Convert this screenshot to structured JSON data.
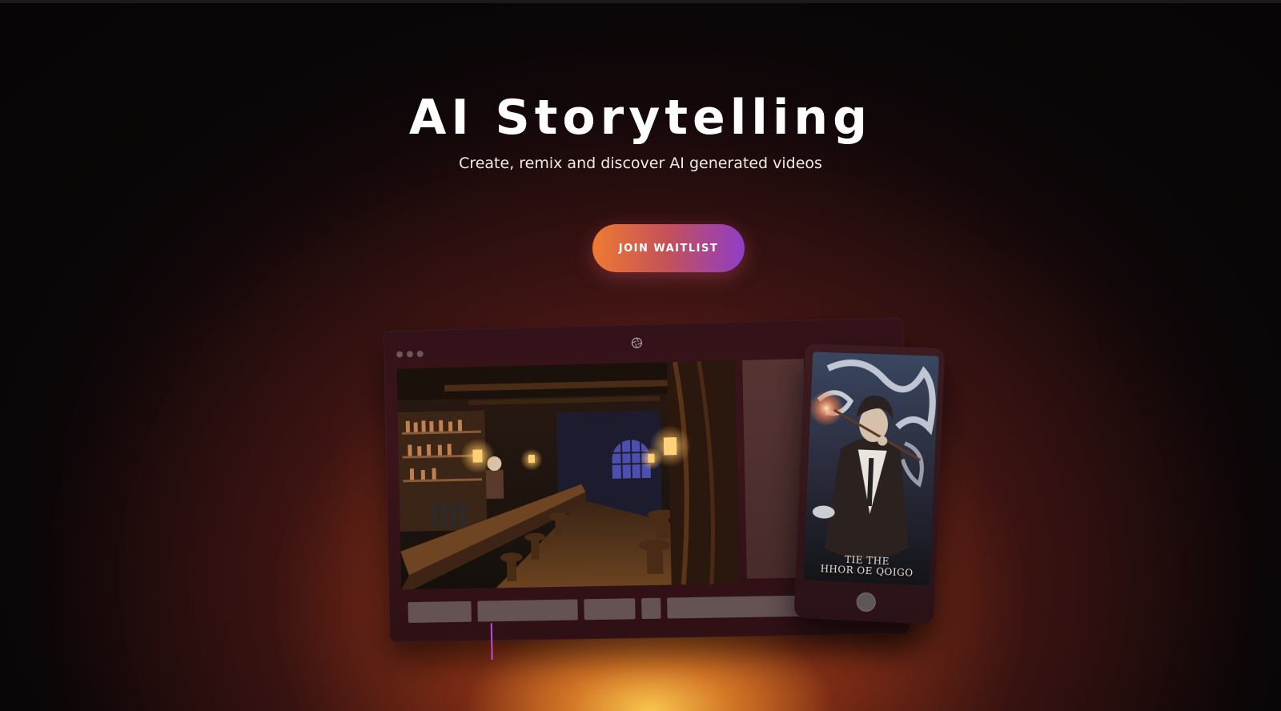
{
  "hero": {
    "title": "AI Storytelling",
    "subtitle": "Create, remix and discover AI generated videos",
    "cta_label": "JOIN WAITLIST"
  },
  "mockup": {
    "phone_poster_title_line1": "TIE THE",
    "phone_poster_title_line2": "HHOR OE QOIGO"
  },
  "colors": {
    "cta_start": "#ef7a33",
    "cta_end": "#8f3dc7",
    "glow": "#f6a22d",
    "timeline_marker": "#c24ad4"
  },
  "icons": {
    "window_controls": "window-dots-icon",
    "app_logo": "aperture-logo-icon"
  }
}
